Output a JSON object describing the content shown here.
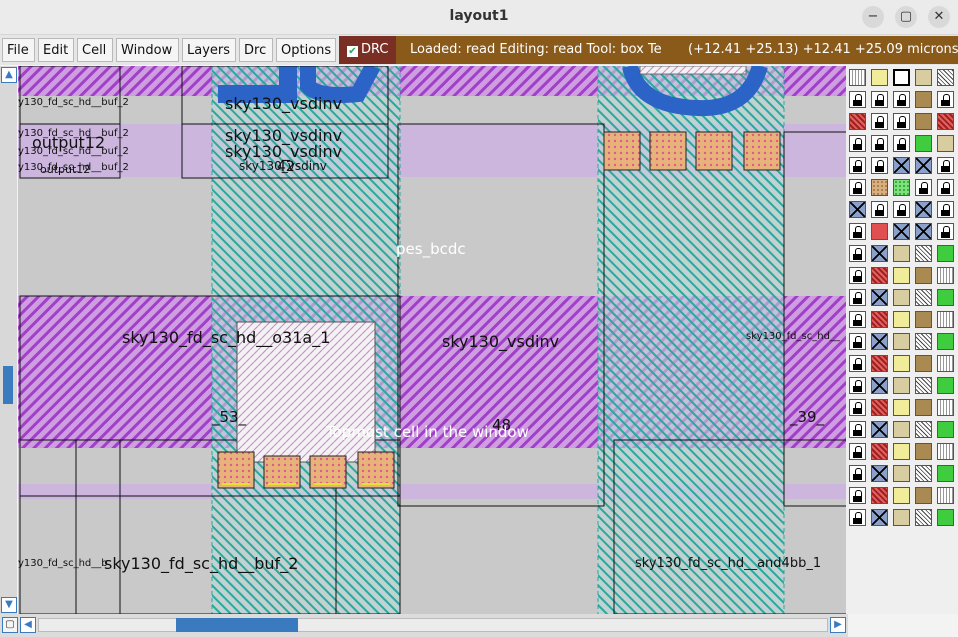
{
  "window": {
    "title": "layout1",
    "minimize_glyph": "−",
    "maximize_glyph": "▢",
    "close_glyph": "✕"
  },
  "menubar": {
    "items": [
      "File",
      "Edit",
      "Cell",
      "Window",
      "Layers",
      "Drc",
      "Options"
    ],
    "drc_toggle": {
      "label": "DRC",
      "checked": true,
      "color": "#7a2f24"
    }
  },
  "status": {
    "message": "Loaded: read  Editing: read  Tool: box   Te",
    "coordinates": "(+12.41 +25.13) +12.41 +25.09 microns",
    "color": "#8a5a1a"
  },
  "layout_labels": {
    "buf2_a": "y130_fd_sc_hd__buf_2",
    "buf2_b": "y130_fd_sc_hd__buf_2",
    "buf2_c": "y130_fd_sc_hd__buf_2",
    "buf2_d": "y130_fd_sc_hd__buf_2",
    "output12_a": "output12",
    "output12_b": "output12",
    "vsdinv_a": "sky130_vsdinv",
    "vsdinv_b": "sky130_vsdinv",
    "vsdinv_c": "sky130_vsdinv",
    "vsdinv_d": "sky130_vsdinv",
    "vsdinv_e": "sky130_vsdinv",
    "num42": "42",
    "pes_bcdc": "pes_bcdc",
    "o31a": "sky130_fd_sc_hd__o31a_1",
    "right_cut": "sky130_fd_sc_hd__",
    "num53": "_53_",
    "num48": "48",
    "num39": "_39_",
    "topmost_hint": "Topmost cell in the window",
    "buf2_bottom_small": "y130_fd_sc_hd__b",
    "buf2_bottom": "sky130_fd_sc_hd__buf_2",
    "and4bb": "sky130_fd_sc_hd__and4bb_1"
  },
  "layer_colors": {
    "metal1": "#a040c8",
    "nwell_stripe": "#2aa8a0",
    "poly": "#d08a6a",
    "wire": "#2b63c6"
  },
  "palette_icons": [
    "dots-layer-icon",
    "yellow-layer-icon",
    "black-layer-icon",
    "tan-layer-icon",
    "diag-layer-icon",
    "locked-layer-icon",
    "locked-layer-icon",
    "locked-layer-icon",
    "brown-layer-icon",
    "locked-layer-icon",
    "red-diag-layer-icon",
    "locked-layer-icon",
    "locked-layer-icon",
    "brown-layer-icon",
    "red-diag-layer-icon",
    "locked-layer-icon",
    "locked-layer-icon",
    "locked-layer-icon",
    "green-layer-icon",
    "tan-layer-icon",
    "locked-layer-icon",
    "locked-layer-icon",
    "cross-layer-icon",
    "cross-layer-icon",
    "locked-layer-icon",
    "locked-layer-icon",
    "tan-dots-layer-icon",
    "green-dots-layer-icon",
    "locked-layer-icon",
    "locked-layer-icon",
    "cross-layer-icon",
    "locked-layer-icon",
    "locked-layer-icon",
    "cross-layer-icon",
    "locked-layer-icon",
    "locked-layer-icon",
    "red-layer-icon",
    "cross-layer-icon",
    "cross-layer-icon",
    "locked-layer-icon"
  ]
}
